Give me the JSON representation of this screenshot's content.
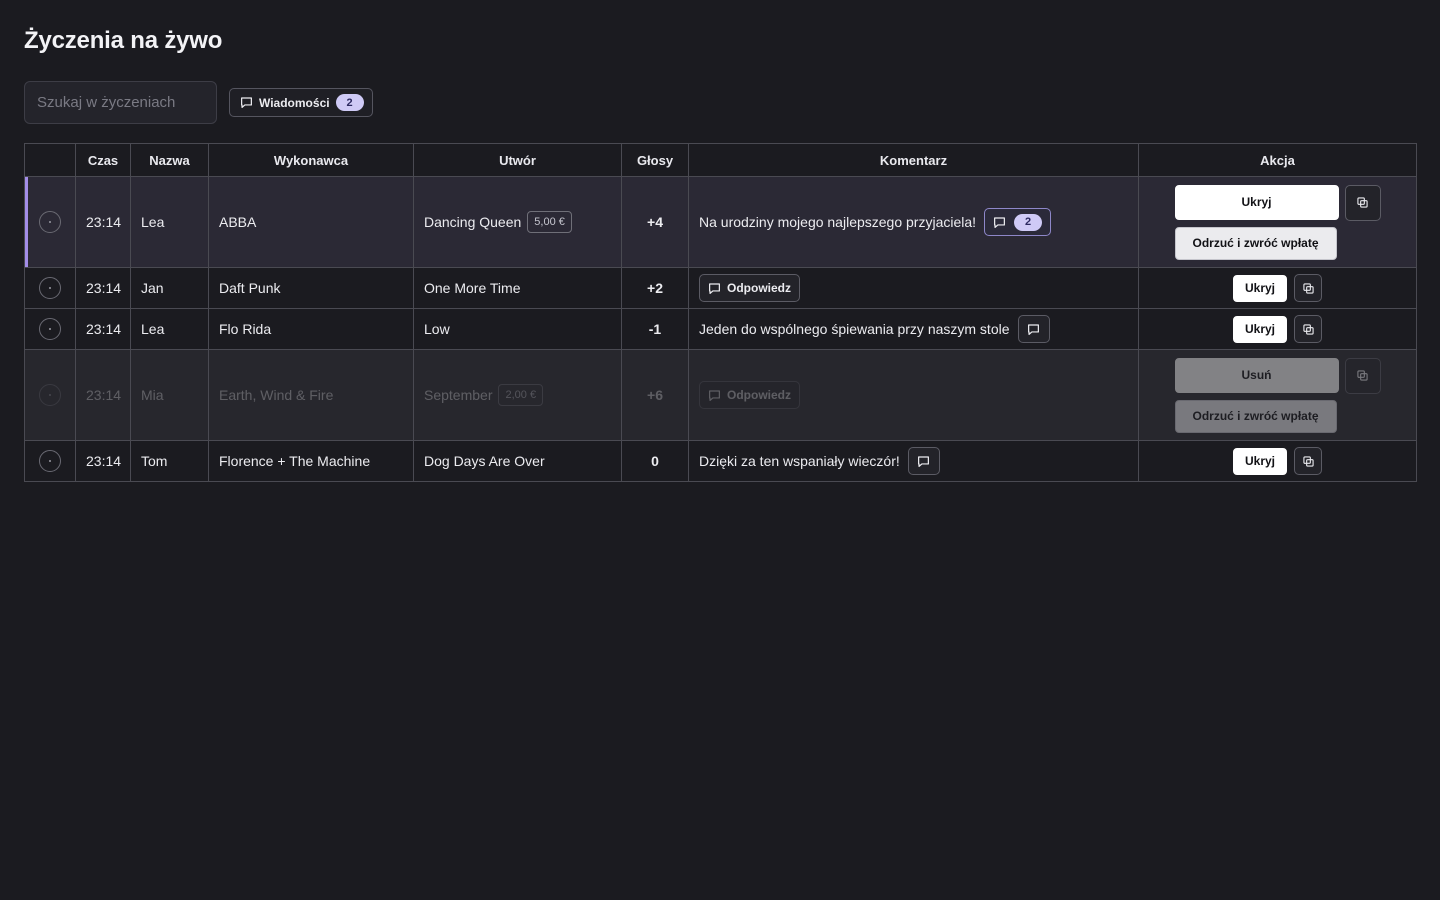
{
  "page": {
    "title": "Życzenia na żywo"
  },
  "toolbar": {
    "search_placeholder": "Szukaj w życzeniach",
    "messages_label": "Wiadomości",
    "messages_count": "2"
  },
  "table": {
    "headers": [
      "",
      "Czas",
      "Nazwa",
      "Wykonawca",
      "Utwór",
      "Głosy",
      "Komentarz",
      "Akcja"
    ],
    "rows": [
      {
        "time": "23:14",
        "name": "Lea",
        "artist": "ABBA",
        "song": "Dancing Queen",
        "price": "5,00 €",
        "votes": "+4",
        "comment": "Na urodziny mojego najlepszego przyjaciela!",
        "comment_count": "2",
        "action_primary": "Ukryj",
        "action_secondary": "Odrzuć i zwróć wpłatę"
      },
      {
        "time": "23:14",
        "name": "Jan",
        "artist": "Daft Punk",
        "song": "One More Time",
        "votes": "+2",
        "reply_label": "Odpowiedz",
        "action_primary": "Ukryj"
      },
      {
        "time": "23:14",
        "name": "Lea",
        "artist": "Flo Rida",
        "song": "Low",
        "votes": "-1",
        "comment": "Jeden do wspólnego śpiewania przy naszym stole",
        "action_primary": "Ukryj"
      },
      {
        "time": "23:14",
        "name": "Mia",
        "artist": "Earth, Wind & Fire",
        "song": "September",
        "price": "2,00 €",
        "votes": "+6",
        "reply_label": "Odpowiedz",
        "action_primary": "Usuń",
        "action_secondary": "Odrzuć i zwróć wpłatę"
      },
      {
        "time": "23:14",
        "name": "Tom",
        "artist": "Florence + The Machine",
        "song": "Dog Days Are Over",
        "votes": "0",
        "comment": "Dzięki za ten wspaniały wieczór!",
        "action_primary": "Ukryj"
      }
    ]
  },
  "colors": {
    "background": "#1b1b20",
    "highlight_accent": "#a38de8",
    "badge_bg": "#cfcaf6"
  }
}
